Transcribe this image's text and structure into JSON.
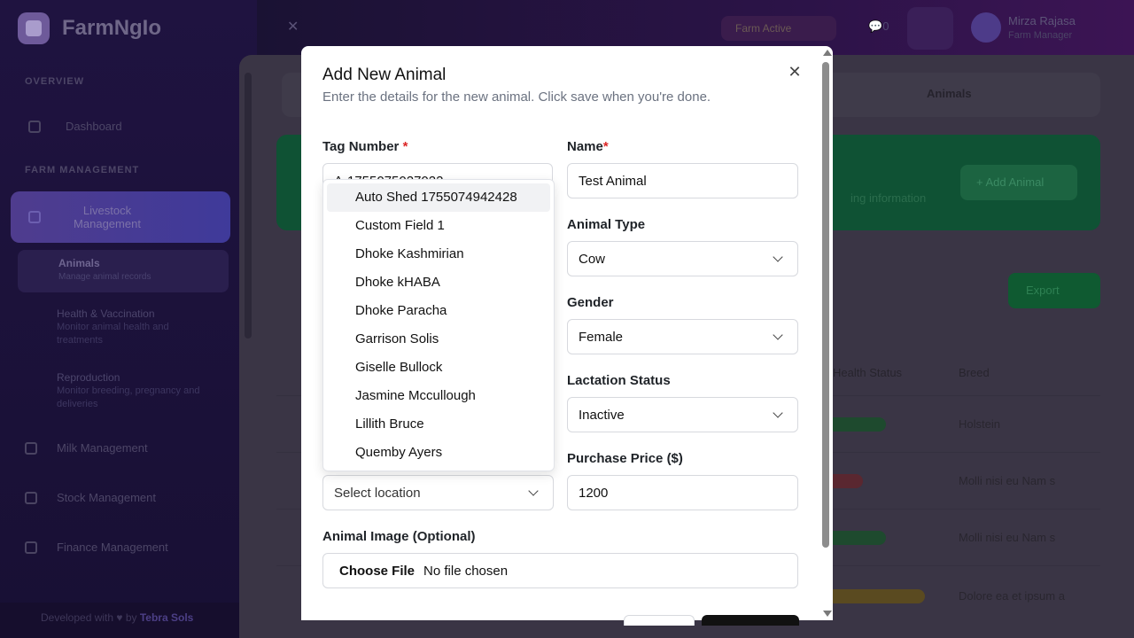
{
  "app": {
    "brand": "FarmNgIo",
    "section_overview": "OVERVIEW",
    "nav_dashboard": "Dashboard",
    "section_farm": "FARM MANAGEMENT",
    "nav_livestock": "Livestock Management",
    "nav_animals": "Animals",
    "nav_animals_sub": "Manage animal records",
    "nav_health": "Health & Vaccination",
    "nav_health_sub": "Monitor animal health and treatments",
    "nav_repro": "Reproduction",
    "nav_repro_sub": "Monitor breeding, pregnancy and deliveries",
    "nav_milk": "Milk Management",
    "nav_stock": "Stock Management",
    "nav_finance": "Finance Management",
    "footer": "Developed with ♥ by ",
    "footer_link": "Tebra Sols",
    "farm_badge": "Farm Active",
    "chat": "0",
    "user_name": "Mirza Rajasa",
    "user_role": "Farm Manager",
    "tab_animals": "Animals",
    "banner_text": "ing information",
    "add_animal": "+ Add Animal",
    "export": "Export",
    "th_health": "Health Status",
    "th_breed": "Breed",
    "row_breeds": [
      "Holstein",
      "Molli nisi eu Nam s",
      "Molli nisi eu Nam s",
      "Dolore ea et ipsum a"
    ]
  },
  "modal": {
    "title": "Add New Animal",
    "description": "Enter the details for the new animal. Click save when you're done.",
    "close_icon": "close-icon",
    "tag_label": "Tag Number",
    "tag_value": "A-1755075027022",
    "name_label": "Name",
    "name_value": "Test Animal",
    "type_label": "Animal Type",
    "type_value": "Cow",
    "gender_label": "Gender",
    "gender_value": "Female",
    "lactation_label": "Lactation Status",
    "lactation_value": "Inactive",
    "price_label": "Purchase Price ($)",
    "price_value": "1200",
    "location_placeholder": "Select location",
    "image_label": "Animal Image (Optional)",
    "file_button": "Choose File",
    "file_status": "No file chosen",
    "required_mark": "*"
  },
  "dropdown": {
    "items": [
      "Auto Shed 1755074942428",
      "Custom Field 1",
      "Dhoke Kashmirian",
      "Dhoke kHABA",
      "Dhoke Paracha",
      "Garrison Solis",
      "Giselle Bullock",
      "Jasmine Mccullough",
      "Lillith Bruce",
      "Quemby Ayers"
    ],
    "highlighted_index": 0
  },
  "colors": {
    "required": "#dc2626",
    "highlight": "#f1f2f4",
    "primary_button": "#111111"
  }
}
